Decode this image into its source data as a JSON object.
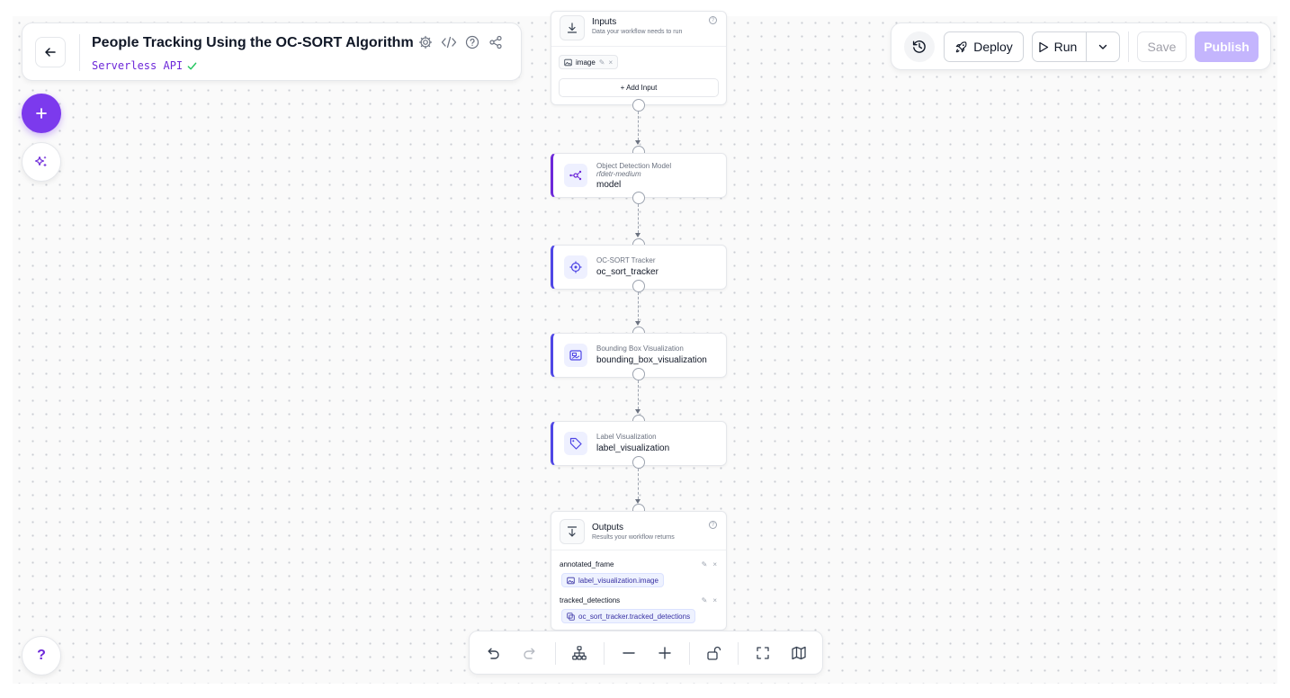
{
  "header": {
    "title": "People Tracking Using the OC-SORT Algorithm",
    "subtitle": "Serverless API",
    "icons": [
      "settings-icon",
      "code-icon",
      "help-icon",
      "share-icon"
    ]
  },
  "toolbar": {
    "history_icon": "history-icon",
    "deploy_label": "Deploy",
    "run_label": "Run",
    "save_label": "Save",
    "publish_label": "Publish"
  },
  "help_fab_label": "?",
  "inputs_node": {
    "title": "Inputs",
    "subtitle": "Data your workflow needs to run",
    "inputs": [
      {
        "name": "image"
      }
    ],
    "add_input_label": "+ Add Input"
  },
  "blocks": [
    {
      "type": "Object Detection Model",
      "model": "rfdetr-medium",
      "name": "model"
    },
    {
      "type": "OC-SORT Tracker",
      "name": "oc_sort_tracker"
    },
    {
      "type": "Bounding Box Visualization",
      "name": "bounding_box_visualization"
    },
    {
      "type": "Label Visualization",
      "name": "label_visualization"
    }
  ],
  "outputs_node": {
    "title": "Outputs",
    "subtitle": "Results your workflow returns",
    "outputs": [
      {
        "name": "annotated_frame",
        "value": "label_visualization.image"
      },
      {
        "name": "tracked_detections",
        "value": "oc_sort_tracker.tracked_detections"
      }
    ]
  },
  "colors": {
    "accent": "#7c3aed",
    "block_border": "#4f46e5",
    "publish_disabled": "#c4b5fd",
    "success": "#22c55e"
  }
}
